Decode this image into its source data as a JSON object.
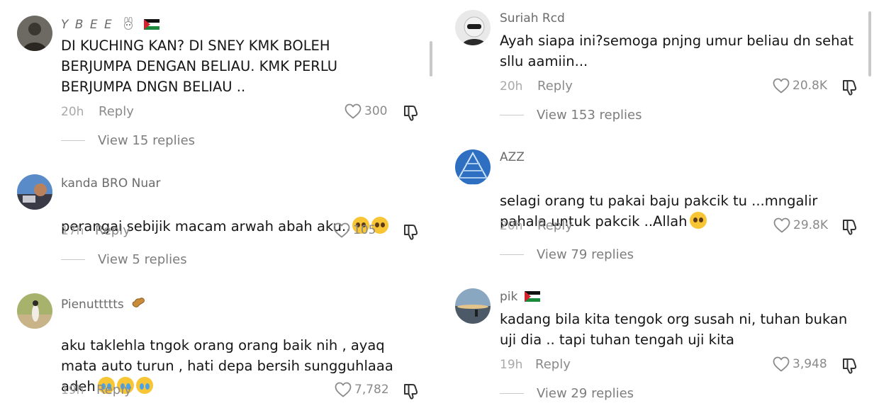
{
  "comments_left": [
    {
      "username": "Y B E E",
      "text": "DI KUCHING KAN? DI SNEY KMK BOLEH\nBERJUMPA DENGAN BELIAU. KMK PERLU\nBERJUMPA DNGN BELIAU ..",
      "time": "20h",
      "reply_label": "Reply",
      "likes": "300",
      "view_replies": "View 15 replies"
    },
    {
      "username": "kanda BRO Nuar",
      "text": "perangai sebijik macam arwah abah aku..",
      "time": "17h",
      "reply_label": "Reply",
      "likes": "105",
      "view_replies": "View 5 replies"
    },
    {
      "username": "Pienuttttts",
      "text": "aku taklehla tngok orang orang baik nih , ayaq\nmata auto turun , hati depa bersih sungguhlaaa\nadeh",
      "time": "19h",
      "reply_label": "Reply",
      "likes": "7,782"
    }
  ],
  "comments_right": [
    {
      "username": "Suriah Rcd",
      "text": "Ayah siapa ini?semoga pnjng umur beliau dn sehat\nsllu aamiin...",
      "time": "20h",
      "reply_label": "Reply",
      "likes": "20.8K",
      "view_replies": "View 153 replies"
    },
    {
      "username": "AZZ",
      "text": "selagi orang tu pakai baju pakcik tu ...mngalir\npahala untuk pakcik ..Allah",
      "time": "20h",
      "reply_label": "Reply",
      "likes": "29.8K",
      "view_replies": "View 79 replies"
    },
    {
      "username": "pik",
      "text": "kadang bila kita tengok org susah ni, tuhan bukan\nuji dia .. tapi tuhan tengah uji kita",
      "time": "19h",
      "reply_label": "Reply",
      "likes": "3,948",
      "view_replies": "View 29 replies"
    }
  ],
  "icons": {
    "like": "heart-outline-icon",
    "dislike": "thumbs-down-outline-icon",
    "emoji_pleading": "pleading-face-emoji",
    "emoji_crying": "loudly-crying-face-emoji",
    "flag": "palestine-flag-emoji",
    "bunny": "bunny-emoji",
    "peanut": "peanut-emoji"
  },
  "colors": {
    "background": "#ffffff",
    "text": "#161616",
    "muted": "#8a8a8a",
    "username": "#6b6b6b"
  }
}
